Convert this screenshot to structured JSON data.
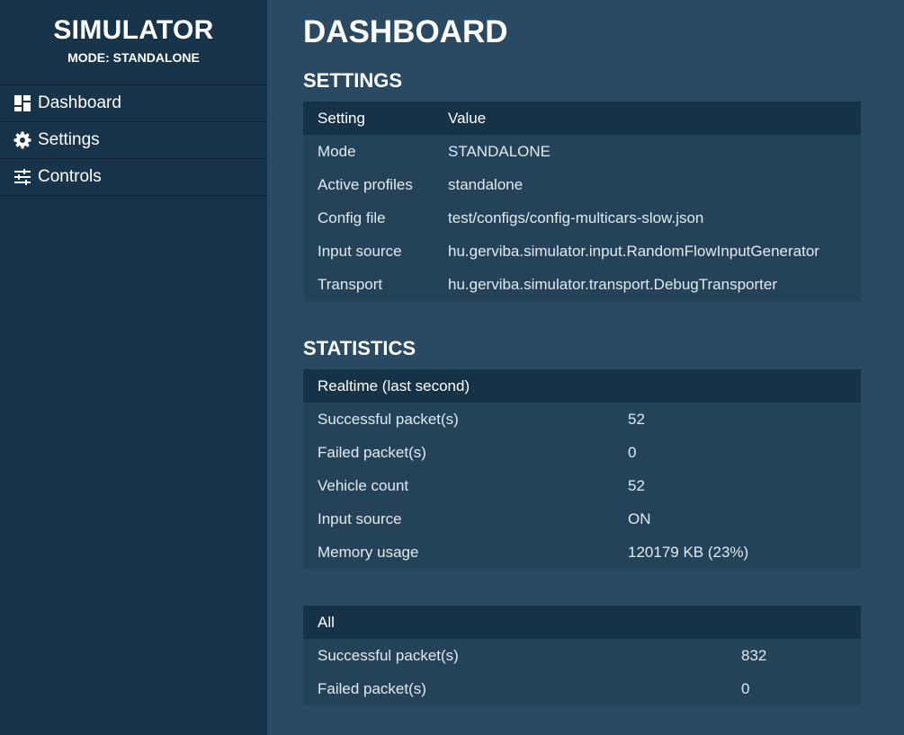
{
  "sidebar": {
    "title": "SIMULATOR",
    "mode_line": "MODE: STANDALONE",
    "items": [
      {
        "icon": "dashboard-icon",
        "label": "Dashboard"
      },
      {
        "icon": "gear-icon",
        "label": "Settings"
      },
      {
        "icon": "sliders-icon",
        "label": "Controls"
      }
    ]
  },
  "main": {
    "title": "DASHBOARD",
    "settings": {
      "heading": "SETTINGS",
      "columns": [
        "Setting",
        "Value"
      ],
      "rows": [
        {
          "key": "Mode",
          "value": "STANDALONE"
        },
        {
          "key": "Active profiles",
          "value": "standalone"
        },
        {
          "key": "Config file",
          "value": "test/configs/config-multicars-slow.json"
        },
        {
          "key": "Input source",
          "value": "hu.gerviba.simulator.input.RandomFlowInputGenerator"
        },
        {
          "key": "Transport",
          "value": "hu.gerviba.simulator.transport.DebugTransporter"
        }
      ]
    },
    "statistics": {
      "heading": "STATISTICS",
      "realtime": {
        "header": "Realtime (last second)",
        "rows": [
          {
            "key": "Successful packet(s)",
            "value": "52"
          },
          {
            "key": "Failed packet(s)",
            "value": "0"
          },
          {
            "key": "Vehicle count",
            "value": "52"
          },
          {
            "key": "Input source",
            "value": "ON"
          },
          {
            "key": "Memory usage",
            "value": "120179 KB (23%)"
          }
        ]
      },
      "all": {
        "header": "All",
        "rows": [
          {
            "key": "Successful packet(s)",
            "value": "832"
          },
          {
            "key": "Failed packet(s)",
            "value": "0"
          }
        ]
      }
    }
  },
  "colors": {
    "sidebar_bg": "#18344a",
    "main_bg": "#2a4a63",
    "table_header_bg": "#163246",
    "table_body_bg": "#244258"
  }
}
